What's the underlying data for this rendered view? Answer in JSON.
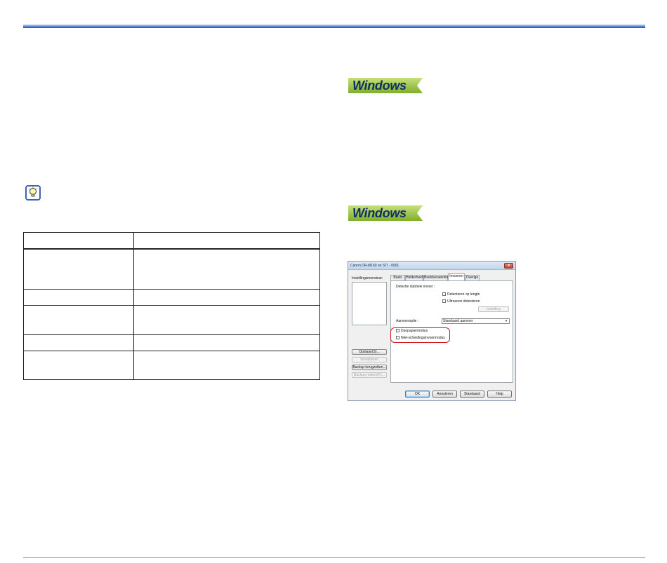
{
  "badges": {
    "windows_label": "Windows"
  },
  "icons": {
    "tip": "lightbulb-icon",
    "close": "close-icon",
    "dropdown": "chevron-down-icon"
  },
  "colors": {
    "header_rule": "#3a64c0",
    "badge_bg": "#9cc24a",
    "highlight": "#d9171e"
  },
  "dialog": {
    "title": "Canon DR-M160 on STI - 0001",
    "left_panel_label": "Instellingsmonsteur:",
    "left_buttons": [
      {
        "label": "Opslaan(S)...",
        "enabled": true
      },
      {
        "label": "Verwijderen",
        "enabled": false
      },
      {
        "label": "Backup terugzetten...",
        "enabled": true
      },
      {
        "label": "Backup maken(K)...",
        "enabled": false
      }
    ],
    "tabs": [
      {
        "label": "Basis",
        "active": false
      },
      {
        "label": "Helderheid",
        "active": false
      },
      {
        "label": "Beeldverwerking",
        "active": false
      },
      {
        "label": "Invoeren",
        "active": true
      },
      {
        "label": "Overige",
        "active": false
      }
    ],
    "panel": {
      "double_feed_label": "Detectie dubbele invoer :",
      "detect_length_label": "Detecteren op lengte",
      "ultrasonic_label": "Ultrasoon detecteren",
      "settings_button": "Instelling",
      "feed_option_label": "Aanvoeroptie :",
      "feed_option_value": "Standaard aanvoer",
      "thick_paper_label": "Dunpapiermodus",
      "non_separation_label": "Niet-scheidingsinvoermodus"
    },
    "footer_buttons": [
      {
        "label": "OK",
        "default": true
      },
      {
        "label": "Annuleren",
        "default": false
      },
      {
        "label": "Standaard",
        "default": false
      },
      {
        "label": "Help",
        "default": false
      }
    ]
  }
}
